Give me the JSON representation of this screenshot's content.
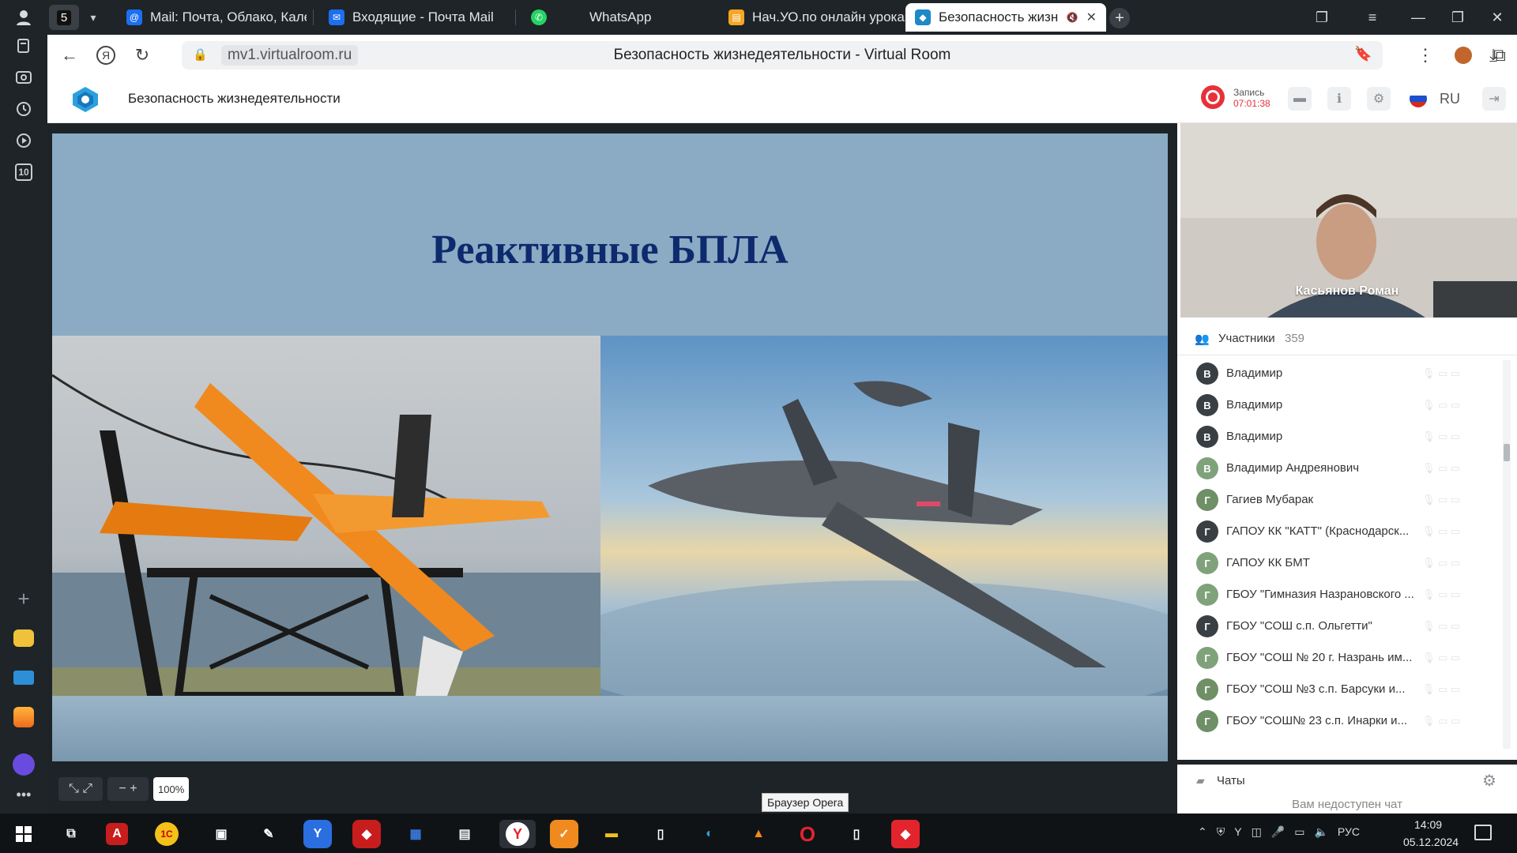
{
  "browser": {
    "tab_group_count": "5",
    "tabs": [
      {
        "label": "Mail: Почта, Облако, Календарь"
      },
      {
        "label": "Входящие - Почта Mail"
      },
      {
        "label": "WhatsApp"
      },
      {
        "label": "Нач.УО.по онлайн урокам"
      },
      {
        "label": "Безопасность жизнедеятельности"
      }
    ],
    "url_domain": "mv1.virtualroom.ru",
    "page_title": "Безопасность жизнедеятельности - Virtual Room",
    "sidebar_badge": "10"
  },
  "app": {
    "title": "Безопасность жизнедеятельности",
    "record_label": "Запись",
    "record_time": "07:01:38",
    "language": "RU"
  },
  "slide": {
    "title": "Реактивные БПЛА",
    "zoom": "100%"
  },
  "camera": {
    "name": "Касьянов Роман"
  },
  "participants": {
    "title": "Участники",
    "count": "359",
    "items": [
      {
        "initial": "В",
        "name": "Владимир",
        "color": "#3a3f44"
      },
      {
        "initial": "В",
        "name": "Владимир",
        "color": "#3a3f44"
      },
      {
        "initial": "В",
        "name": "Владимир",
        "color": "#3a3f44"
      },
      {
        "initial": "В",
        "name": "Владимир Андреянович",
        "color": "#7fa27a"
      },
      {
        "initial": "Г",
        "name": "Гагиев Мубарак",
        "color": "#6f8f66"
      },
      {
        "initial": "Г",
        "name": "ГАПОУ КК \"КАТТ\" (Краснодарск...",
        "color": "#3a3f44"
      },
      {
        "initial": "Г",
        "name": "ГАПОУ КК БМТ",
        "color": "#7fa27a"
      },
      {
        "initial": "Г",
        "name": "ГБОУ \"Гимназия Назрановского ...",
        "color": "#7fa27a"
      },
      {
        "initial": "Г",
        "name": "ГБОУ \"СОШ с.п. Ольгетти\"",
        "color": "#3a3f44"
      },
      {
        "initial": "Г",
        "name": "ГБОУ \"СОШ № 20 г. Назрань им...",
        "color": "#7fa27a"
      },
      {
        "initial": "Г",
        "name": "ГБОУ \"СОШ №3 с.п. Барсуки и...",
        "color": "#6f8f66"
      },
      {
        "initial": "Г",
        "name": "ГБОУ \"СОШ№ 23 с.п. Инарки и...",
        "color": "#6f8f66"
      }
    ]
  },
  "chat": {
    "title": "Чаты",
    "unavailable": "Вам недоступен чат"
  },
  "tooltip": "Браузер Opera",
  "taskbar": {
    "lang": "РУС",
    "time": "14:09",
    "date": "05.12.2024"
  },
  "colors": {
    "record": "#e8303a",
    "slide_bg": "#8aabc3",
    "slide_title": "#0e2a6e"
  }
}
